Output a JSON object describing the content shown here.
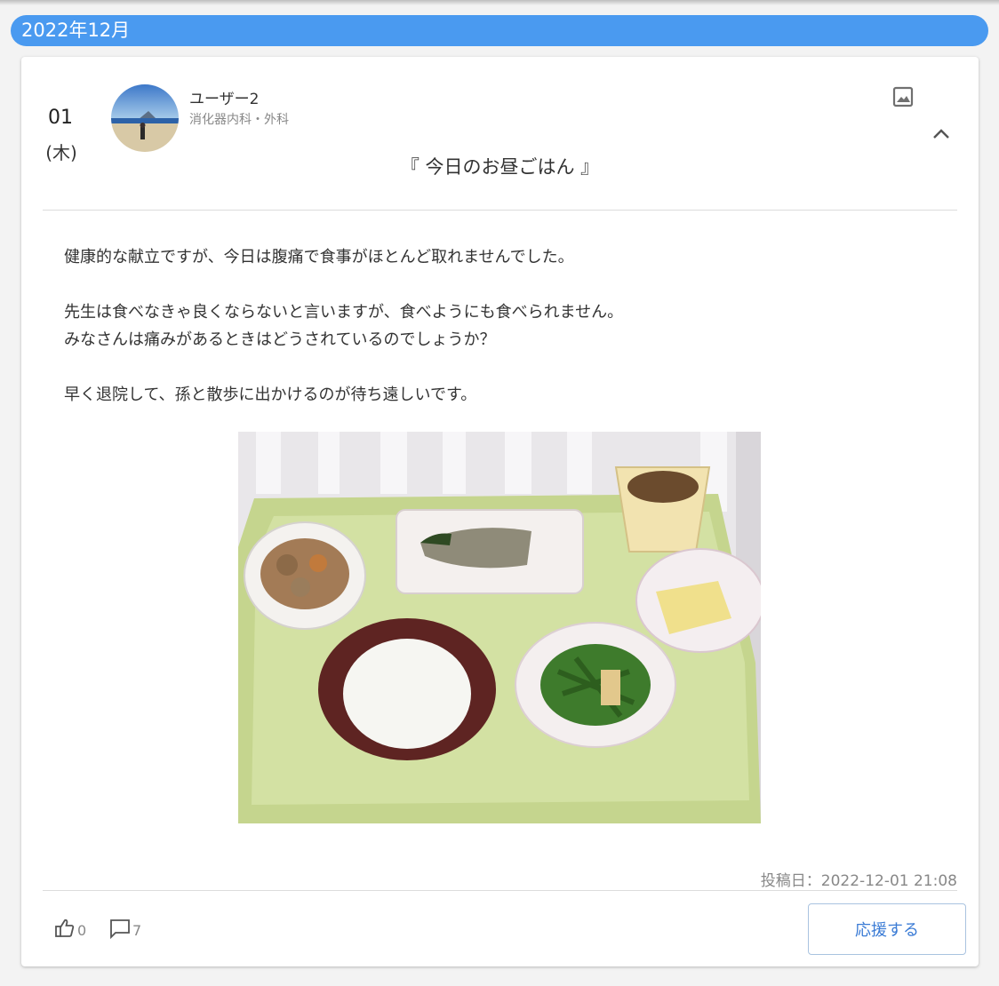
{
  "month_header": "2022年12月",
  "post": {
    "day": "01",
    "weekday": "(木)",
    "user_name": "ユーザー2",
    "department": "消化器内科・外科",
    "title": "『 今日のお昼ごはん 』",
    "body": [
      "健康的な献立ですが、今日は腹痛で食事がほとんど取れませんでした。",
      "",
      "先生は食べなきゃ良くならないと言いますが、食べようにも食べられません。",
      "みなさんは痛みがあるときはどうされているのでしょうか？",
      "",
      "早く退院して、孫と散歩に出かけるのが待ち遠しいです。"
    ],
    "posted_at": "投稿日：2022-12-01 21:08",
    "like_count": "0",
    "comment_count": "7",
    "cheer_label": "応援する"
  },
  "colors": {
    "accent": "#4a9af0",
    "button_text": "#3a7bd5"
  },
  "icons": [
    "image-icon",
    "chevron-up-icon",
    "thumbs-up-icon",
    "comment-icon"
  ]
}
